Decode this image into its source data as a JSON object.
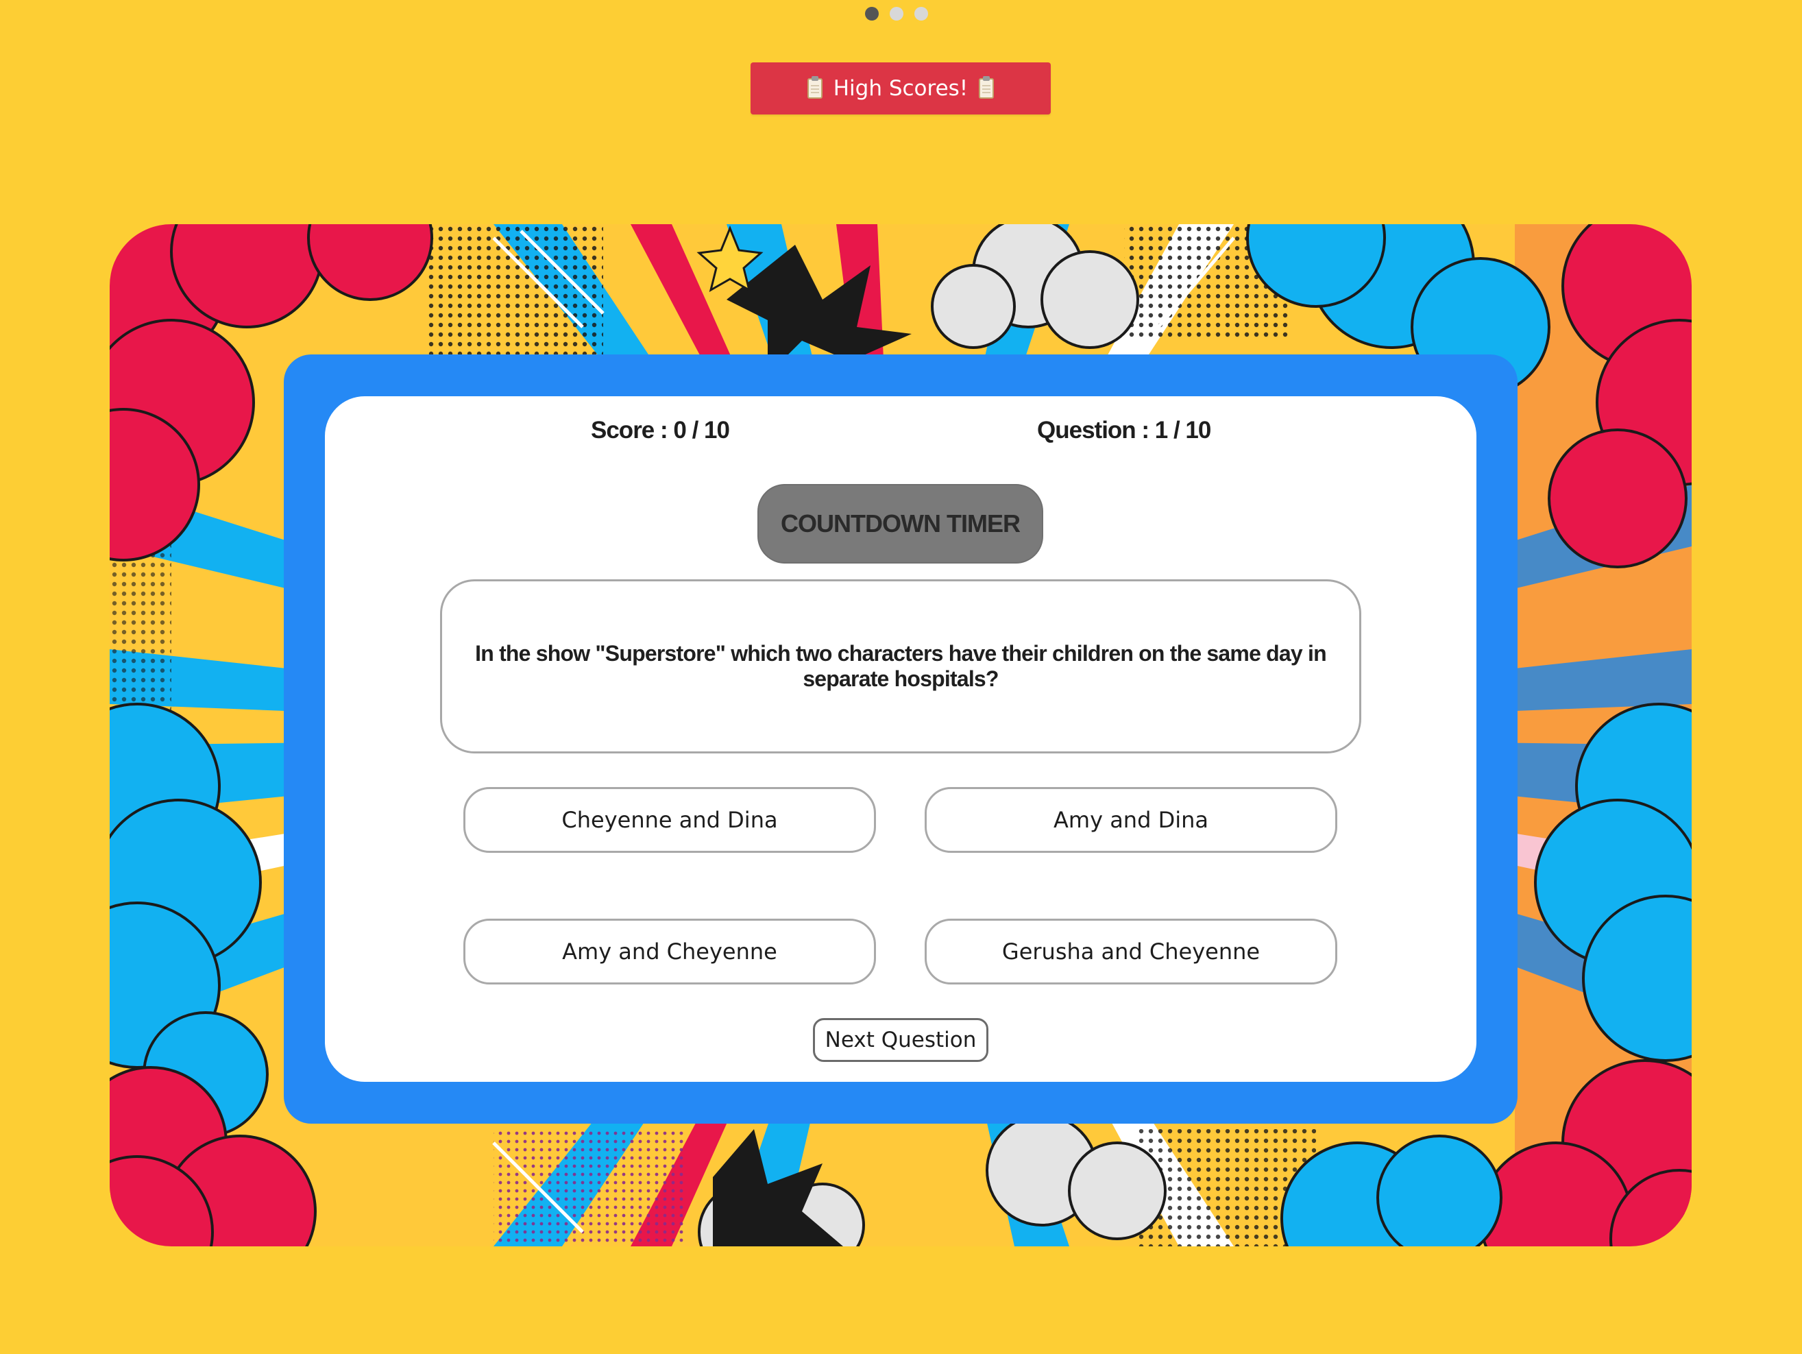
{
  "carousel": {
    "dot_count": 3,
    "active_index": 0
  },
  "header": {
    "high_scores_label": "High Scores!"
  },
  "stats": {
    "score": "Score : 0 / 10",
    "question": "Question : 1 / 10"
  },
  "timer": {
    "label": "COUNTDOWN TIMER"
  },
  "quiz": {
    "question": "In the show \"Superstore\" which two characters have their children on the same day in separate hospitals?",
    "answers": [
      "Cheyenne and Dina",
      "Amy and Dina",
      "Amy and Cheyenne",
      "Gerusha and Cheyenne"
    ],
    "next_label": "Next Question"
  },
  "colors": {
    "page_background": "#FDCE34",
    "high_scores_button": "#DC3545",
    "frame_blue": "#2589F5",
    "timer_gray": "#7A7A7A",
    "comic_red": "#E8174A",
    "comic_cyan": "#12B1F1",
    "comic_yellow": "#FFC93A",
    "dot_active": "#555555",
    "dot_inactive": "#D8D8D8"
  },
  "icons": [
    "clipboard-icon",
    "star-icon"
  ]
}
